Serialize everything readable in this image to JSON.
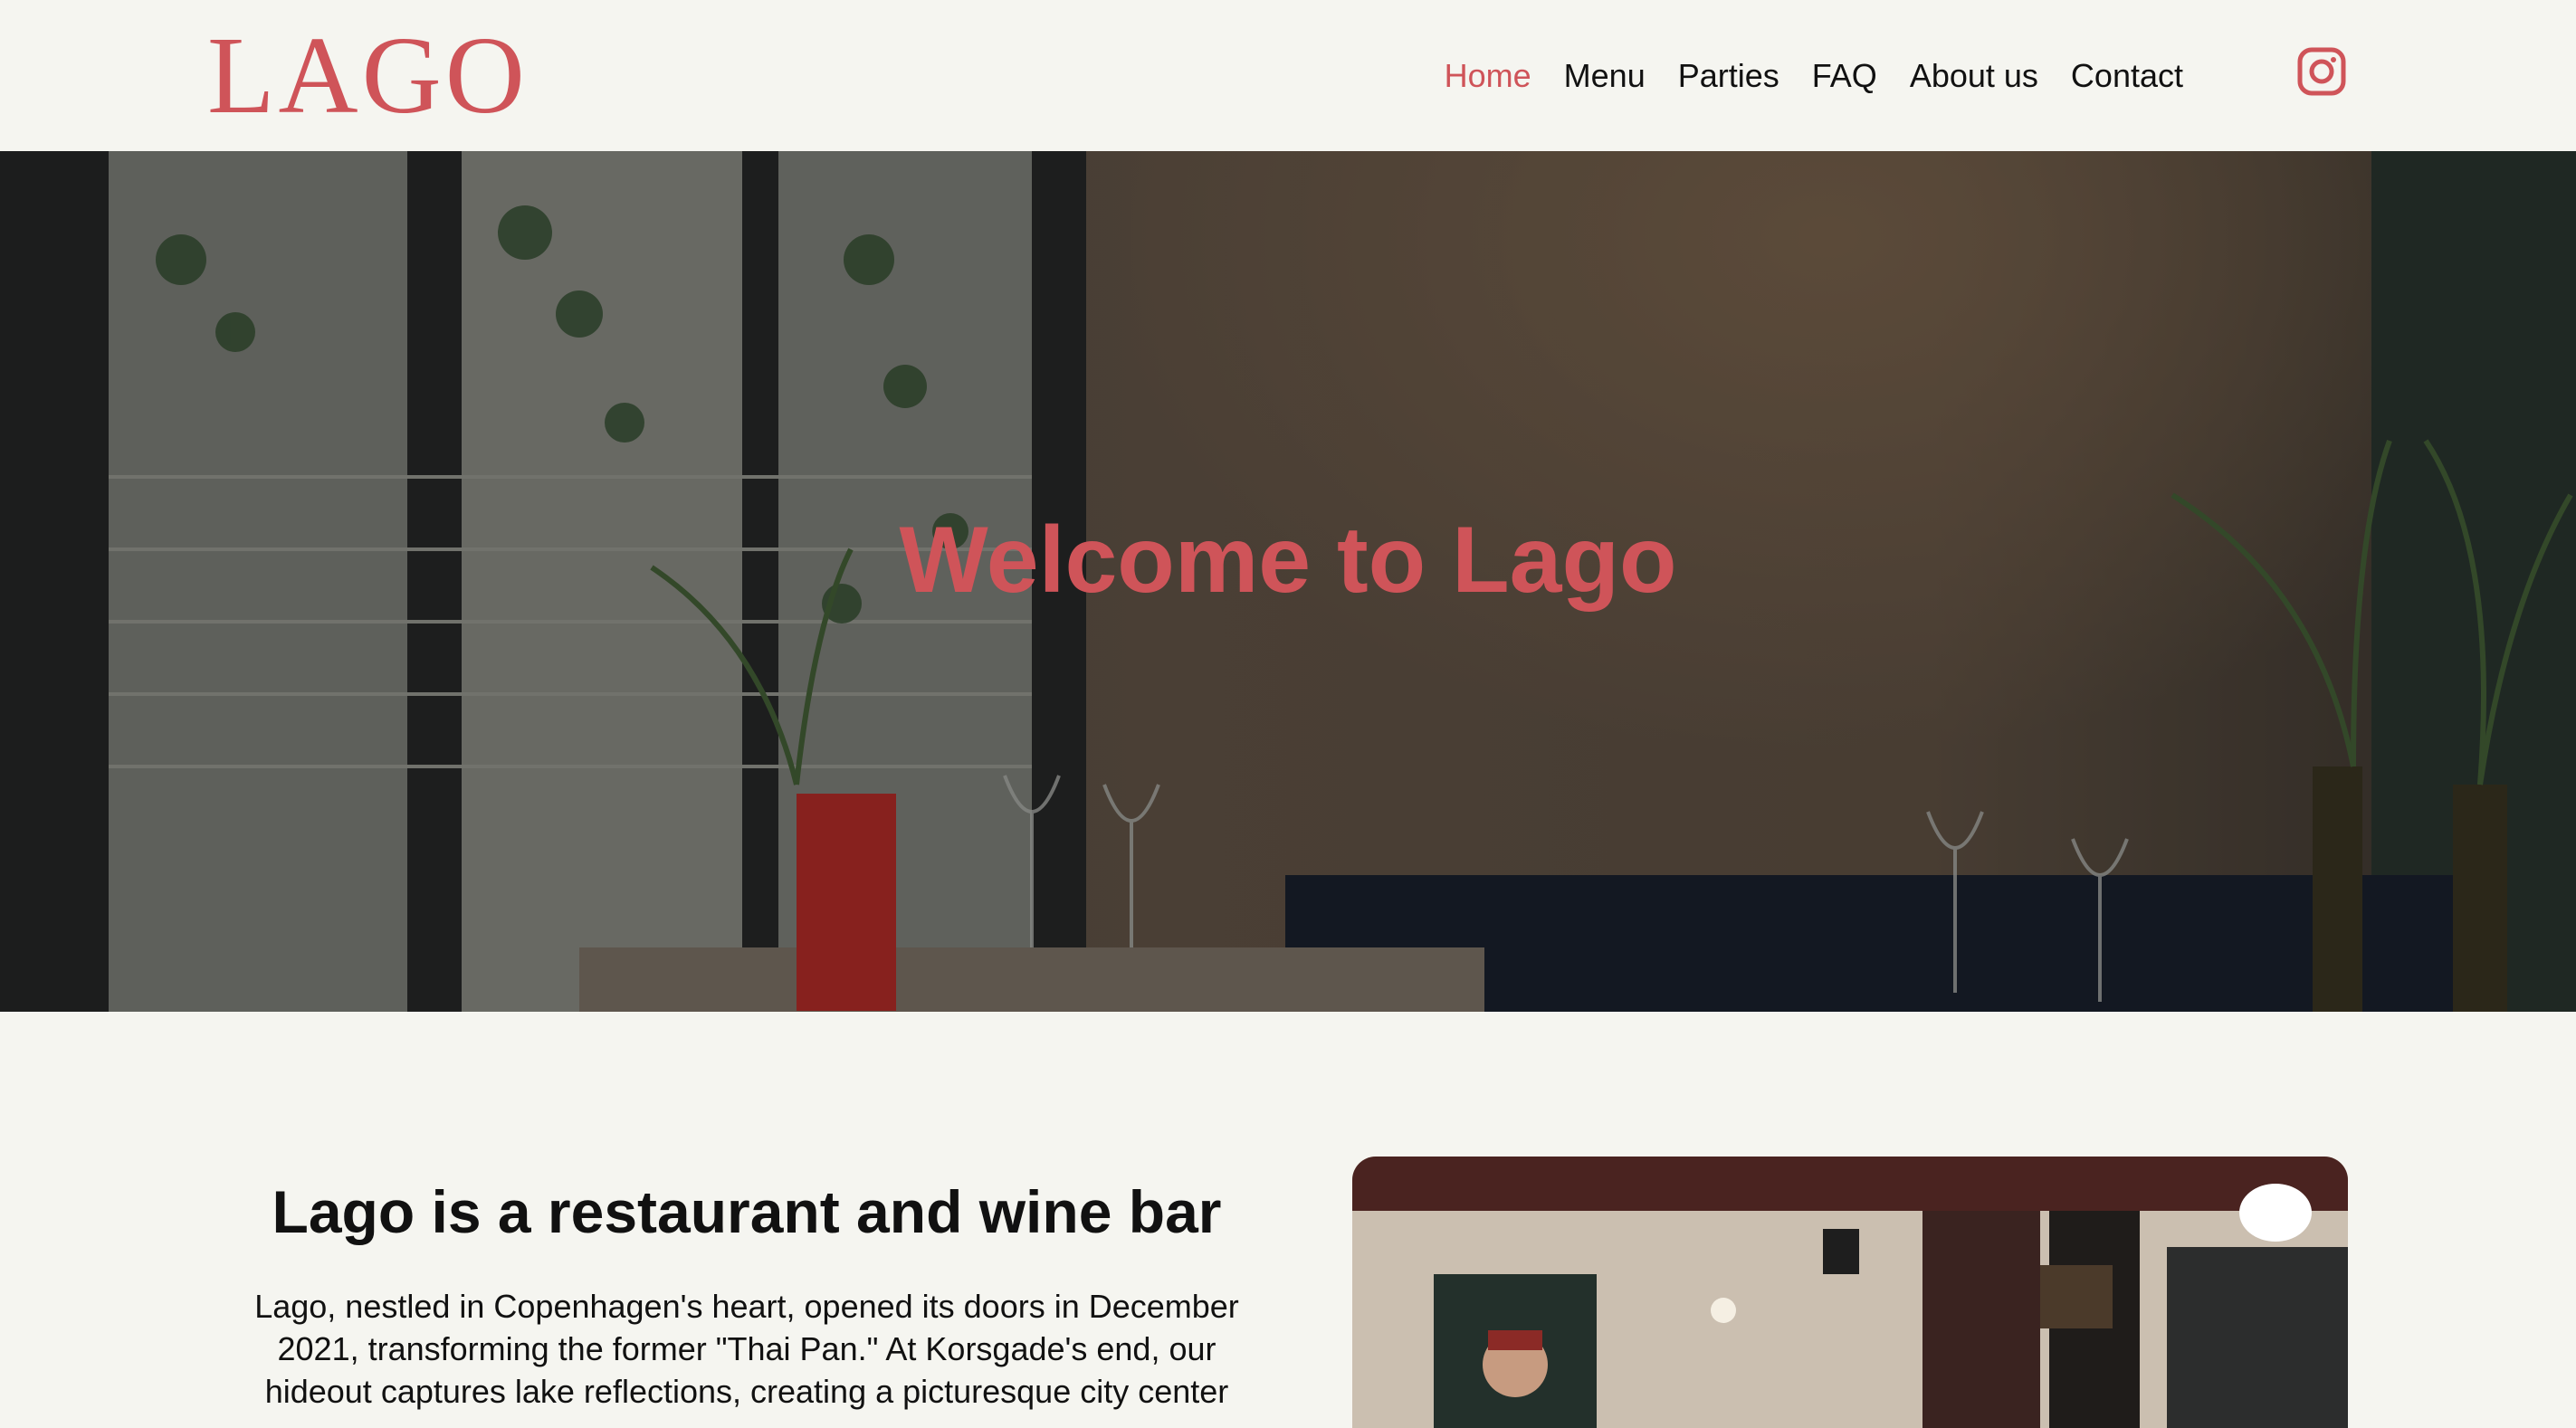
{
  "brand": {
    "logo_text": "LAGO",
    "accent_color": "#cf5459"
  },
  "nav": {
    "items": [
      {
        "label": "Home",
        "active": true
      },
      {
        "label": "Menu",
        "active": false
      },
      {
        "label": "Parties",
        "active": false
      },
      {
        "label": "FAQ",
        "active": false
      },
      {
        "label": "About us",
        "active": false
      },
      {
        "label": "Contact",
        "active": false
      }
    ],
    "social_icon": "instagram-icon"
  },
  "hero": {
    "title": "Welcome to Lago"
  },
  "intro": {
    "heading": "Lago is a restaurant and wine bar",
    "body": "Lago, nestled in Copenhagen's heart, opened its doors in December 2021, transforming the former \"Thai Pan.\" At Korsgade's end, our hideout captures lake reflections, creating a picturesque city center"
  }
}
